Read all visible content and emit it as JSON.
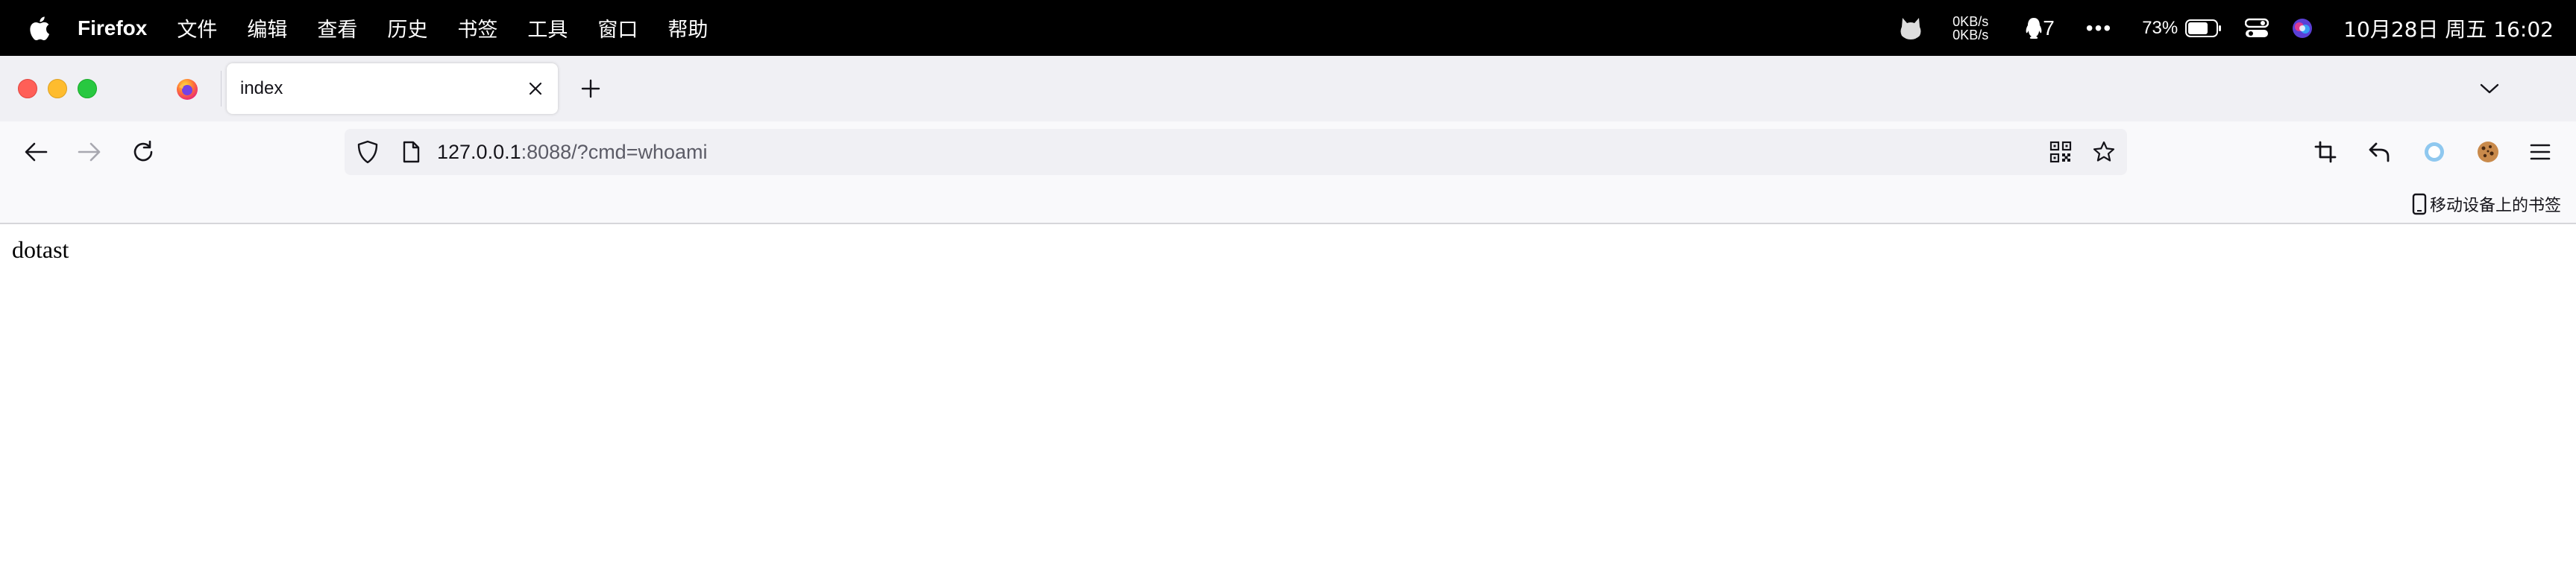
{
  "menubar": {
    "app_name": "Firefox",
    "items": [
      "文件",
      "编辑",
      "查看",
      "历史",
      "书签",
      "工具",
      "窗口",
      "帮助"
    ],
    "net_up": "0KB/s",
    "net_down": "0KB/s",
    "qq_count": "7",
    "battery_pct": "73%",
    "clock": "10月28日 周五  16:02"
  },
  "tabs": [
    {
      "title": "index",
      "active": true
    }
  ],
  "urlbar": {
    "host": "127.0.0.1",
    "rest": ":8088/?cmd=whoami"
  },
  "bookmarks": {
    "mobile_label": "移动设备上的书签"
  },
  "page": {
    "text": "dotast"
  },
  "colors": {
    "menubar_bg": "#000000",
    "tabstrip_bg": "#f0f0f4",
    "toolbar_bg": "#f9f9fb",
    "urlbar_bg": "#f0f0f4",
    "close_dot": "#ff5f57",
    "min_dot": "#febc2e",
    "max_dot": "#28c840"
  }
}
